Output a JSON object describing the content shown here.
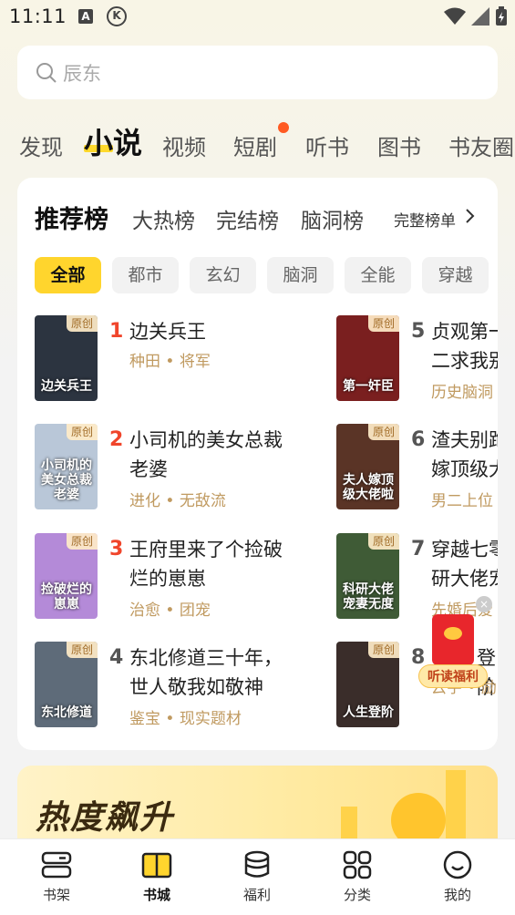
{
  "status_bar": {
    "time": "11:11",
    "icon_a": "A",
    "icon_k": "K"
  },
  "search": {
    "placeholder": "辰东"
  },
  "top_tabs": [
    {
      "label": "发现"
    },
    {
      "label": "小说",
      "active": true
    },
    {
      "label": "视频"
    },
    {
      "label": "短剧",
      "badge": "red-dot"
    },
    {
      "label": "听书"
    },
    {
      "label": "图书"
    },
    {
      "label": "书友圈"
    }
  ],
  "ranking": {
    "title": "推荐榜",
    "tabs": [
      "大热榜",
      "完结榜",
      "脑洞榜"
    ],
    "full_list_label": "完整榜单",
    "chips": [
      {
        "label": "全部",
        "active": true
      },
      {
        "label": "都市"
      },
      {
        "label": "玄幻"
      },
      {
        "label": "脑洞"
      },
      {
        "label": "全能"
      },
      {
        "label": "穿越"
      }
    ],
    "badge_label": "原创",
    "books": [
      {
        "rank": "1",
        "title_l1": "边关兵王",
        "title_l2": "",
        "tags": "种田 • 将军",
        "cover_text": "边关兵王",
        "cover_color": "#2c3440"
      },
      {
        "rank": "2",
        "title_l1": "小司机的美女总裁",
        "title_l2": "老婆",
        "tags": "进化 • 无敌流",
        "cover_text": "小司机的美女总裁老婆",
        "cover_color": "#b9c7d8"
      },
      {
        "rank": "3",
        "title_l1": "王府里来了个捡破",
        "title_l2": "烂的崽崽",
        "tags": "治愈 • 团宠",
        "cover_text": "捡破烂的崽崽",
        "cover_color": "#b48ad8"
      },
      {
        "rank": "4",
        "title_l1": "东北修道三十年，",
        "title_l2": "世人敬我如敬神",
        "tags": "鉴宝 • 现实题材",
        "cover_text": "东北修道",
        "cover_color": "#5e6b79"
      },
      {
        "rank": "5",
        "title_l1": "贞观第一",
        "title_l2": "二求我别",
        "tags": "历史脑洞",
        "cover_text": "第一奸臣",
        "cover_color": "#7a1f1f"
      },
      {
        "rank": "6",
        "title_l1": "渣夫别跑",
        "title_l2": "嫁顶级大",
        "tags": "男二上位",
        "cover_text": "夫人嫁顶级大佬啦",
        "cover_color": "#5a3426"
      },
      {
        "rank": "7",
        "title_l1": "穿越七零",
        "title_l2": "研大佬宠",
        "tags": "先婚后爱",
        "cover_text": "科研大佬宠妻无度",
        "cover_color": "#3f5b36"
      },
      {
        "rank": "8",
        "title_l1": "登阶",
        "title_l2": "",
        "tags": "云宇 • 励",
        "cover_text": "人生登阶",
        "cover_color": "#3a2d2a"
      }
    ]
  },
  "red_packet": {
    "label": "听读福利"
  },
  "trend_banner": {
    "title": "热度飙升"
  },
  "bottom_nav": [
    {
      "label": "书架",
      "icon": "bookshelf-icon"
    },
    {
      "label": "书城",
      "icon": "bookstore-icon",
      "active": true
    },
    {
      "label": "福利",
      "icon": "benefit-icon"
    },
    {
      "label": "分类",
      "icon": "category-icon"
    },
    {
      "label": "我的",
      "icon": "profile-icon"
    }
  ],
  "colors": {
    "accent_yellow": "#ffd52d",
    "rank_red": "#f0452b",
    "tag_brown": "#c09a60"
  }
}
